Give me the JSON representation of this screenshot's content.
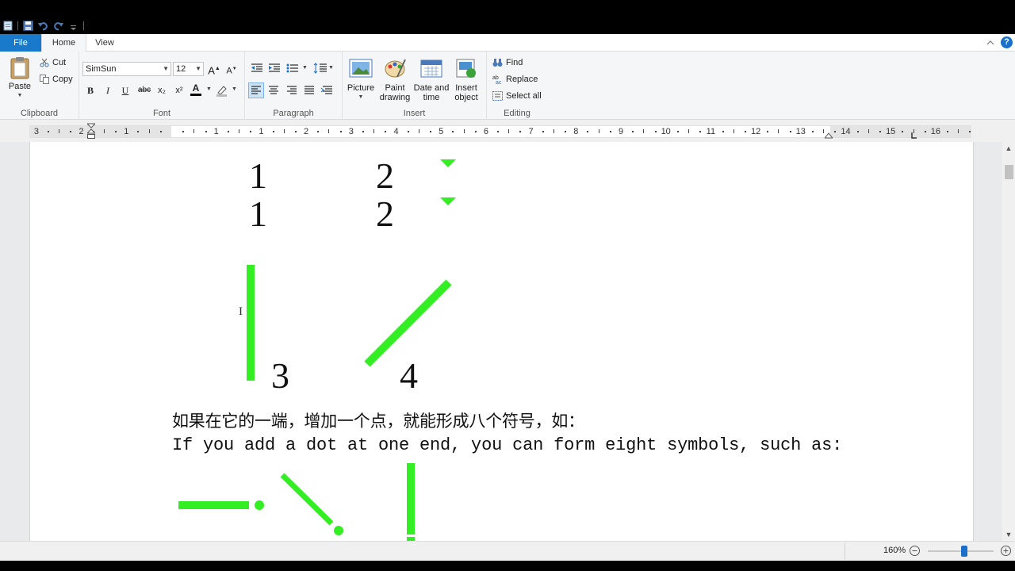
{
  "qat": {
    "icons": [
      "paint-app-icon",
      "save-icon",
      "undo-icon",
      "redo-icon",
      "customize-qat-icon"
    ]
  },
  "tabs": {
    "file": "File",
    "home": "Home",
    "view": "View"
  },
  "clipboard": {
    "paste": "Paste",
    "cut": "Cut",
    "copy": "Copy",
    "label": "Clipboard"
  },
  "font": {
    "family": "SimSun",
    "size": "12",
    "label": "Font",
    "bold": "B",
    "italic": "I",
    "underline": "U",
    "strike": "abc",
    "sub": "x₂",
    "sup": "x²",
    "grow": "A",
    "shrink": "A",
    "color": "A"
  },
  "paragraph": {
    "label": "Paragraph"
  },
  "insert": {
    "picture": "Picture",
    "paint_drawing": "Paint drawing",
    "date_time": "Date and time",
    "insert_object": "Insert object",
    "label": "Insert"
  },
  "editing": {
    "find": "Find",
    "replace": "Replace",
    "select_all": "Select all",
    "label": "Editing"
  },
  "ruler": {
    "numbers": [
      "3",
      "2",
      "1",
      "1",
      "1",
      "2",
      "3",
      "4",
      "5",
      "6",
      "7",
      "8",
      "9",
      "10",
      "11",
      "12",
      "13",
      "14",
      "15",
      "16",
      "17"
    ]
  },
  "doc": {
    "labels": {
      "n1": "1",
      "n2": "2",
      "n1b": "1",
      "n2b": "2",
      "n3": "3",
      "n4": "4"
    },
    "chinese_line": "如果在它的一端，增加一个点，就能形成八个符号，如：",
    "english_line": "If you add a dot at one end, you can form eight symbols, such as:",
    "accent_color": "#33ee22"
  },
  "status": {
    "zoom": "160%"
  }
}
